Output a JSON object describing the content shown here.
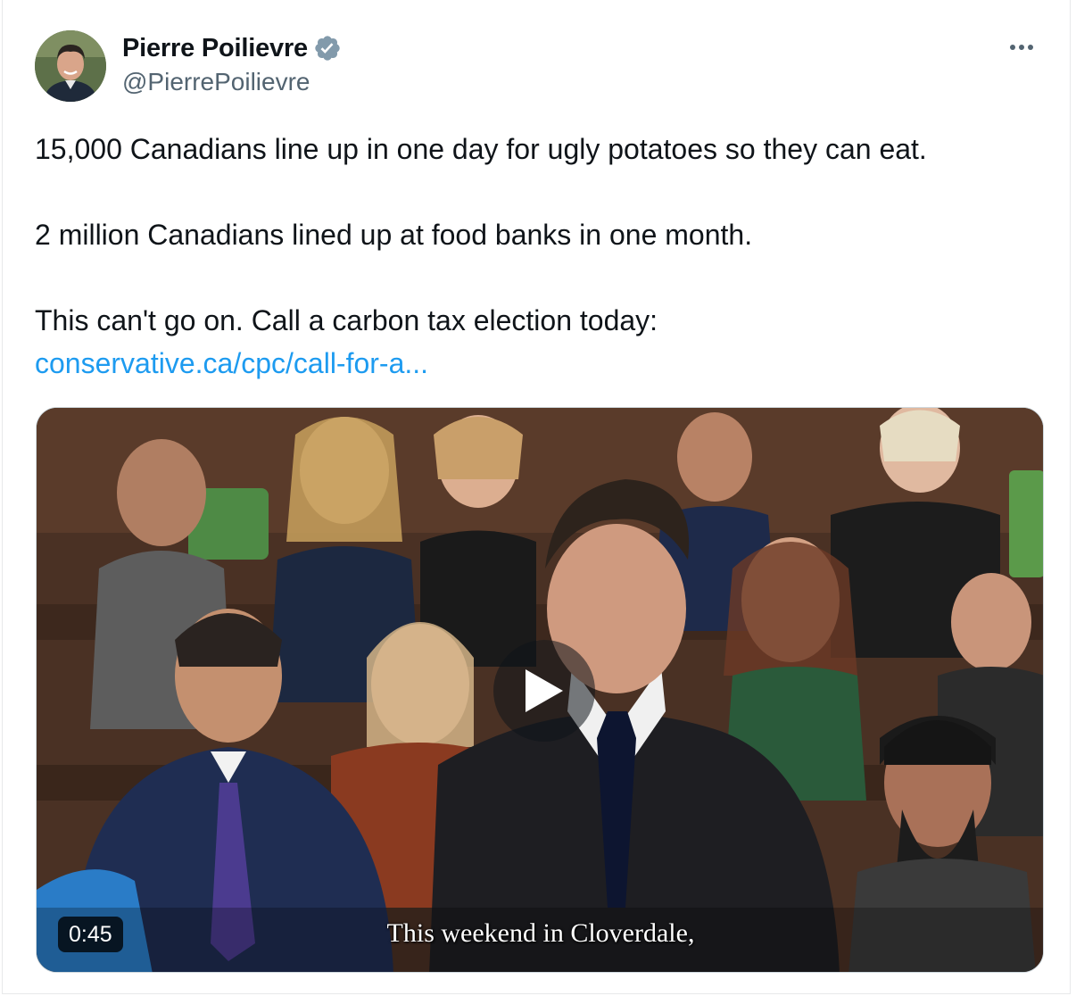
{
  "author": {
    "display_name": "Pierre Poilievre",
    "handle": "@PierrePoilievre",
    "verified": true,
    "avatar_icon": "profile-photo"
  },
  "tweet": {
    "line1": "15,000 Canadians line up in one day for ugly potatoes so they can eat.",
    "line2": "2 million Canadians lined up at food banks in one month.",
    "line3": "This can't go on. Call a carbon tax election today:",
    "link_text": "conservative.ca/cpc/call-for-a..."
  },
  "media": {
    "type": "video",
    "duration": "0:45",
    "caption": "This weekend in Cloverdale,",
    "play_icon": "play-icon"
  },
  "colors": {
    "link": "#1d9bf0",
    "text": "#0f1419",
    "secondary": "#536471",
    "verified_badge": "#829aab"
  }
}
